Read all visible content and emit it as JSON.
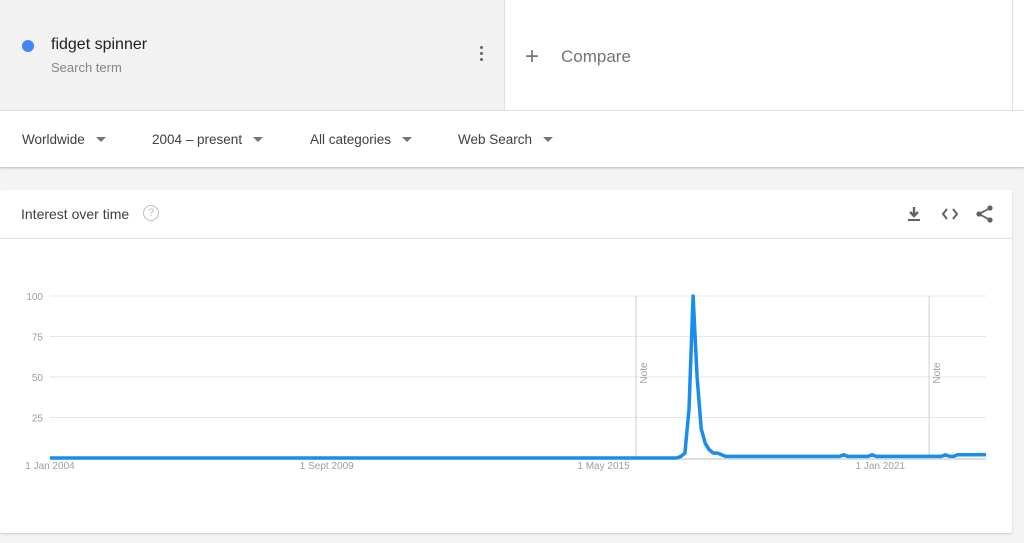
{
  "search_term": {
    "name": "fidget spinner",
    "subtitle": "Search term",
    "color": "#4285f4"
  },
  "compare": {
    "label": "Compare",
    "icon": "plus-icon"
  },
  "filters": [
    {
      "label": "Worldwide"
    },
    {
      "label": "2004 – present"
    },
    {
      "label": "All categories"
    },
    {
      "label": "Web Search"
    }
  ],
  "card": {
    "title": "Interest over time",
    "help_icon": "help-circle-icon",
    "tools": [
      "download-icon",
      "embed-code-icon",
      "share-icon"
    ]
  },
  "chart_data": {
    "type": "line",
    "title": "Interest over time",
    "xlabel": "",
    "ylabel": "",
    "ylim": [
      0,
      100
    ],
    "yticks": [
      25,
      50,
      75,
      100
    ],
    "xtick_labels": [
      "1 Jan 2004",
      "1 Sept 2009",
      "1 May 2015",
      "1 Jan 2021"
    ],
    "xtick_month_index": [
      0,
      68,
      136,
      204
    ],
    "x_start": "Jan 2004",
    "x_unit": "month",
    "grid": true,
    "line_color": "#1a8cf0",
    "notes": [
      {
        "label": "Note",
        "month_index": 144
      },
      {
        "label": "Note",
        "month_index": 216
      }
    ],
    "series": [
      {
        "name": "fidget spinner",
        "segments": [
          {
            "from": 0,
            "to": 154,
            "value": 0
          },
          {
            "from": 155,
            "to": 155,
            "value": 1
          },
          {
            "from": 156,
            "to": 156,
            "value": 3
          },
          {
            "from": 157,
            "to": 157,
            "value": 30
          },
          {
            "from": 158,
            "to": 158,
            "value": 100
          },
          {
            "from": 159,
            "to": 159,
            "value": 50
          },
          {
            "from": 160,
            "to": 160,
            "value": 18
          },
          {
            "from": 161,
            "to": 161,
            "value": 9
          },
          {
            "from": 162,
            "to": 162,
            "value": 5
          },
          {
            "from": 163,
            "to": 164,
            "value": 3
          },
          {
            "from": 165,
            "to": 165,
            "value": 2
          },
          {
            "from": 166,
            "to": 194,
            "value": 1
          },
          {
            "from": 195,
            "to": 195,
            "value": 2
          },
          {
            "from": 196,
            "to": 201,
            "value": 1
          },
          {
            "from": 202,
            "to": 202,
            "value": 2
          },
          {
            "from": 203,
            "to": 219,
            "value": 1
          },
          {
            "from": 220,
            "to": 220,
            "value": 2
          },
          {
            "from": 221,
            "to": 222,
            "value": 1
          },
          {
            "from": 223,
            "to": 230,
            "value": 2
          }
        ]
      }
    ]
  }
}
